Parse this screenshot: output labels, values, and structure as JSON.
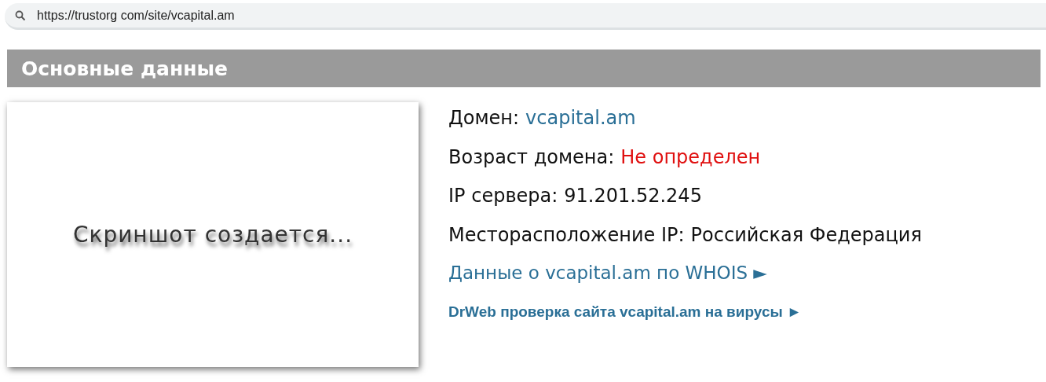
{
  "address_bar": {
    "url": "https://trustorg com/site/vcapital.am"
  },
  "section": {
    "title": "Основные данные"
  },
  "screenshot": {
    "caption": "Скриншот создается..."
  },
  "details": [
    {
      "kind": "link",
      "label": "Домен:",
      "value": "vcapital.am"
    },
    {
      "kind": "warning",
      "label": "Возраст домена:",
      "value": "Не определен"
    },
    {
      "kind": "plain",
      "label": "IP сервера:",
      "value": "91.201.52.245"
    },
    {
      "kind": "plain",
      "label": "Месторасположение IP:",
      "value": "Российская Федерация"
    }
  ],
  "links": [
    {
      "kind": "large",
      "text": "Данные о vcapital.am по WHOIS",
      "arrow": "►"
    },
    {
      "kind": "small",
      "text": "DrWeb проверка сайта vcapital.am на вирусы",
      "arrow": "►"
    }
  ]
}
